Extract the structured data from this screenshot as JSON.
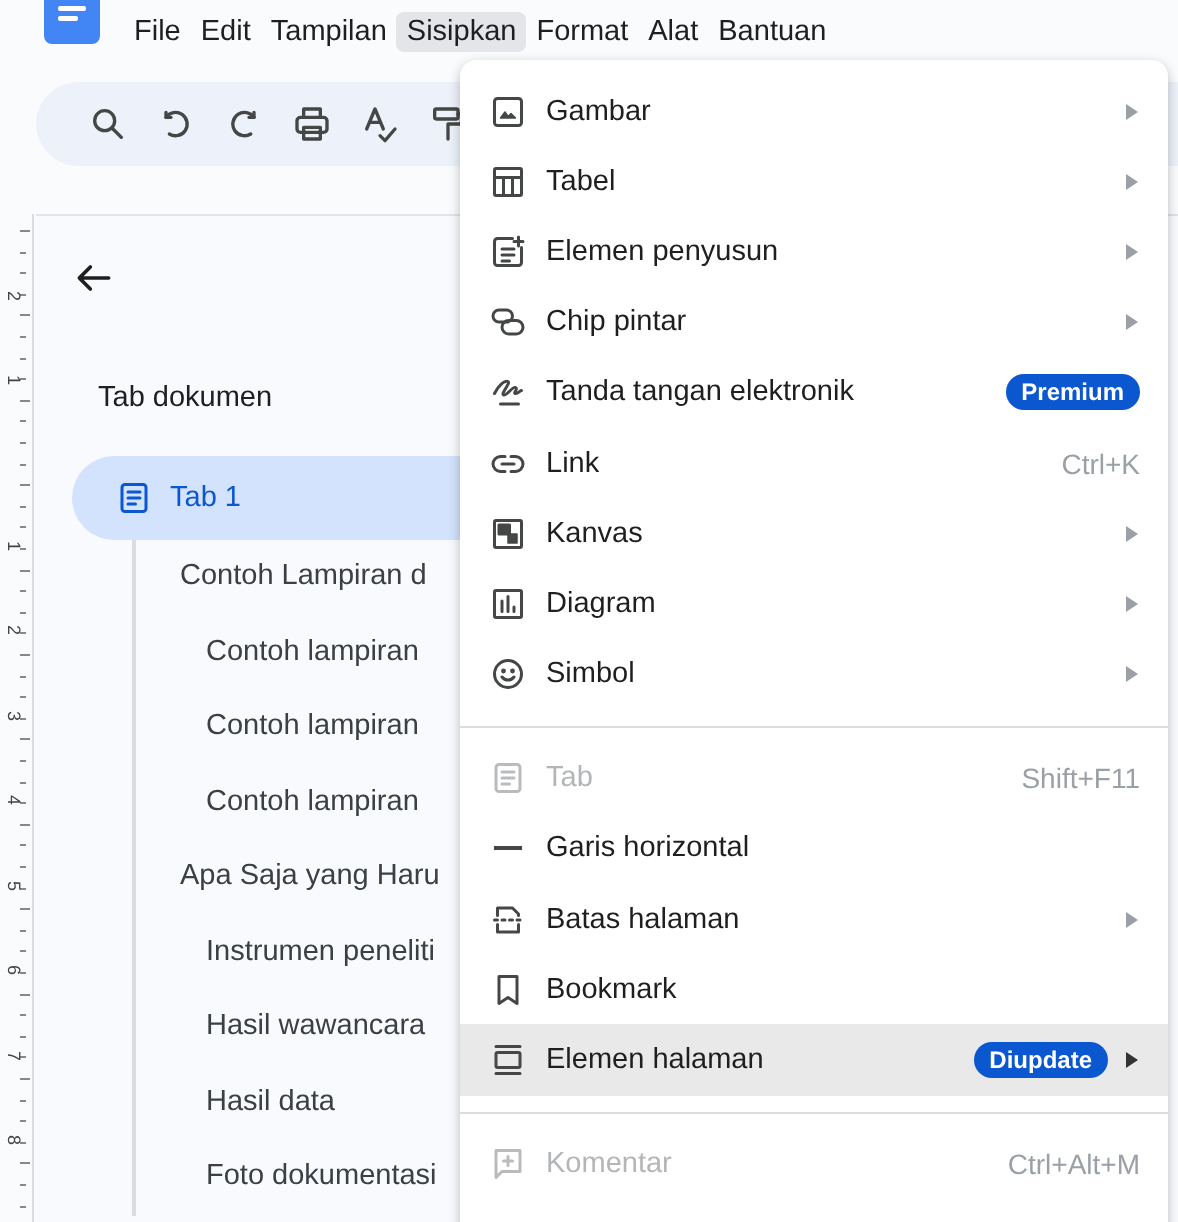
{
  "menubar": [
    {
      "label": "File",
      "selected": false
    },
    {
      "label": "Edit",
      "selected": false
    },
    {
      "label": "Tampilan",
      "selected": false
    },
    {
      "label": "Sisipkan",
      "selected": true
    },
    {
      "label": "Format",
      "selected": false
    },
    {
      "label": "Alat",
      "selected": false
    },
    {
      "label": "Bantuan",
      "selected": false
    }
  ],
  "ruler": {
    "labels": [
      "2",
      "1",
      "1",
      "2",
      "3",
      "4",
      "5",
      "6",
      "7",
      "8"
    ]
  },
  "sidebar": {
    "title": "Tab dokumen",
    "tabs": [
      {
        "label": "Tab 1",
        "selected": true,
        "children": [
          {
            "label": "Contoh Lampiran d",
            "children": [
              {
                "label": "Contoh lampiran"
              },
              {
                "label": "Contoh lampiran"
              },
              {
                "label": "Contoh lampiran"
              }
            ]
          },
          {
            "label": "Apa Saja yang Haru",
            "children": [
              {
                "label": "Instrumen peneliti"
              },
              {
                "label": "Hasil wawancara"
              },
              {
                "label": "Hasil data"
              },
              {
                "label": "Foto dokumentasi"
              }
            ]
          }
        ]
      }
    ]
  },
  "insert_menu": {
    "sections": [
      [
        {
          "label": "Gambar",
          "submenu": true,
          "disabled": false,
          "selected": false
        },
        {
          "label": "Tabel",
          "submenu": true,
          "disabled": false,
          "selected": false
        },
        {
          "label": "Elemen penyusun",
          "submenu": true,
          "disabled": false,
          "selected": false
        },
        {
          "label": "Chip pintar",
          "submenu": true,
          "disabled": false,
          "selected": false
        },
        {
          "label": "Tanda tangan elektronik",
          "badge": "Premium",
          "submenu": false,
          "disabled": false,
          "selected": false
        },
        {
          "label": "Link",
          "shortcut": "Ctrl+K",
          "submenu": false,
          "disabled": false,
          "selected": false
        },
        {
          "label": "Kanvas",
          "submenu": true,
          "disabled": false,
          "selected": false
        },
        {
          "label": "Diagram",
          "submenu": true,
          "disabled": false,
          "selected": false
        },
        {
          "label": "Simbol",
          "submenu": true,
          "disabled": false,
          "selected": false
        }
      ],
      [
        {
          "label": "Tab",
          "shortcut": "Shift+F11",
          "submenu": false,
          "disabled": true,
          "selected": false
        },
        {
          "label": "Garis horizontal",
          "submenu": false,
          "disabled": false,
          "selected": false
        },
        {
          "label": "Batas halaman",
          "submenu": true,
          "disabled": false,
          "selected": false
        },
        {
          "label": "Bookmark",
          "submenu": false,
          "disabled": false,
          "selected": false
        },
        {
          "label": "Elemen halaman",
          "badge": "Diupdate",
          "submenu": true,
          "disabled": false,
          "selected": true
        }
      ],
      [
        {
          "label": "Komentar",
          "shortcut": "Ctrl+Alt+M",
          "submenu": false,
          "disabled": true,
          "selected": false
        }
      ]
    ]
  }
}
